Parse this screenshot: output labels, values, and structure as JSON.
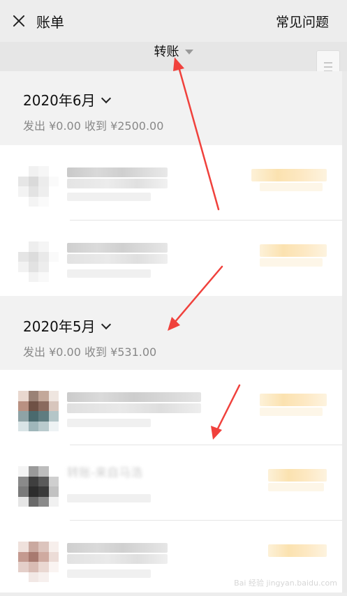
{
  "header": {
    "title": "账单",
    "faq_label": "常见问题"
  },
  "filter": {
    "label": "转账"
  },
  "sections": [
    {
      "month": "2020年6月",
      "summary": "发出 ¥0.00 收到 ¥2500.00"
    },
    {
      "month": "2020年5月",
      "summary": "发出 ¥0.00 收到 ¥531.00"
    }
  ],
  "blurred_row_title": "转账-来自马浩",
  "watermark": "Bai 经验 jingyan.baidu.com",
  "colors": {
    "background": "#ededed",
    "section_bg": "#f2f2f2",
    "annotation_arrow": "#f0413c"
  }
}
